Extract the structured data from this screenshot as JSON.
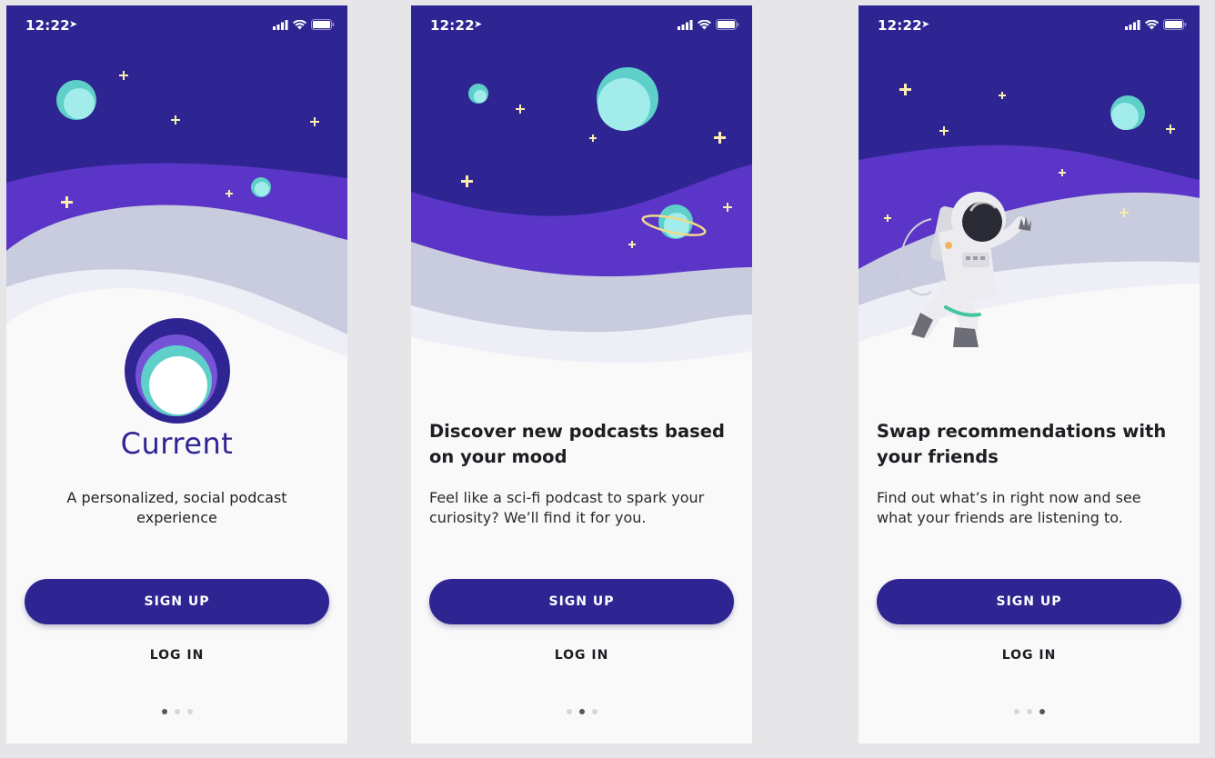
{
  "colors": {
    "primary": "#2f2592",
    "violet": "#5a35c8",
    "sky": "#2f2592",
    "hill_gray": "#c9cbde",
    "hill_light": "#eeeff6",
    "teal": "#5ecfc9",
    "teal_light": "#a2ecec",
    "star": "#fbedb0",
    "background": "#f9f9fa"
  },
  "status_bar": {
    "time": "12:22",
    "icons": [
      "location-arrow-icon",
      "signal-icon",
      "wifi-icon",
      "battery-icon"
    ]
  },
  "screens": [
    {
      "brand": "Current",
      "tagline": "A personalized, social podcast experience",
      "signup_label": "SIGN UP",
      "login_label": "LOG IN",
      "page_index": 0
    },
    {
      "headline": "Discover new podcasts based on your mood",
      "body": "Feel like a sci-fi podcast to spark your curiosity? We’ll find it for you.",
      "signup_label": "SIGN UP",
      "login_label": "LOG IN",
      "page_index": 1
    },
    {
      "headline": "Swap recommendations with your friends",
      "body": "Find out what’s in right now and see what your friends are listening to.",
      "signup_label": "SIGN UP",
      "login_label": "LOG IN",
      "page_index": 2
    }
  ],
  "page_count": 3
}
